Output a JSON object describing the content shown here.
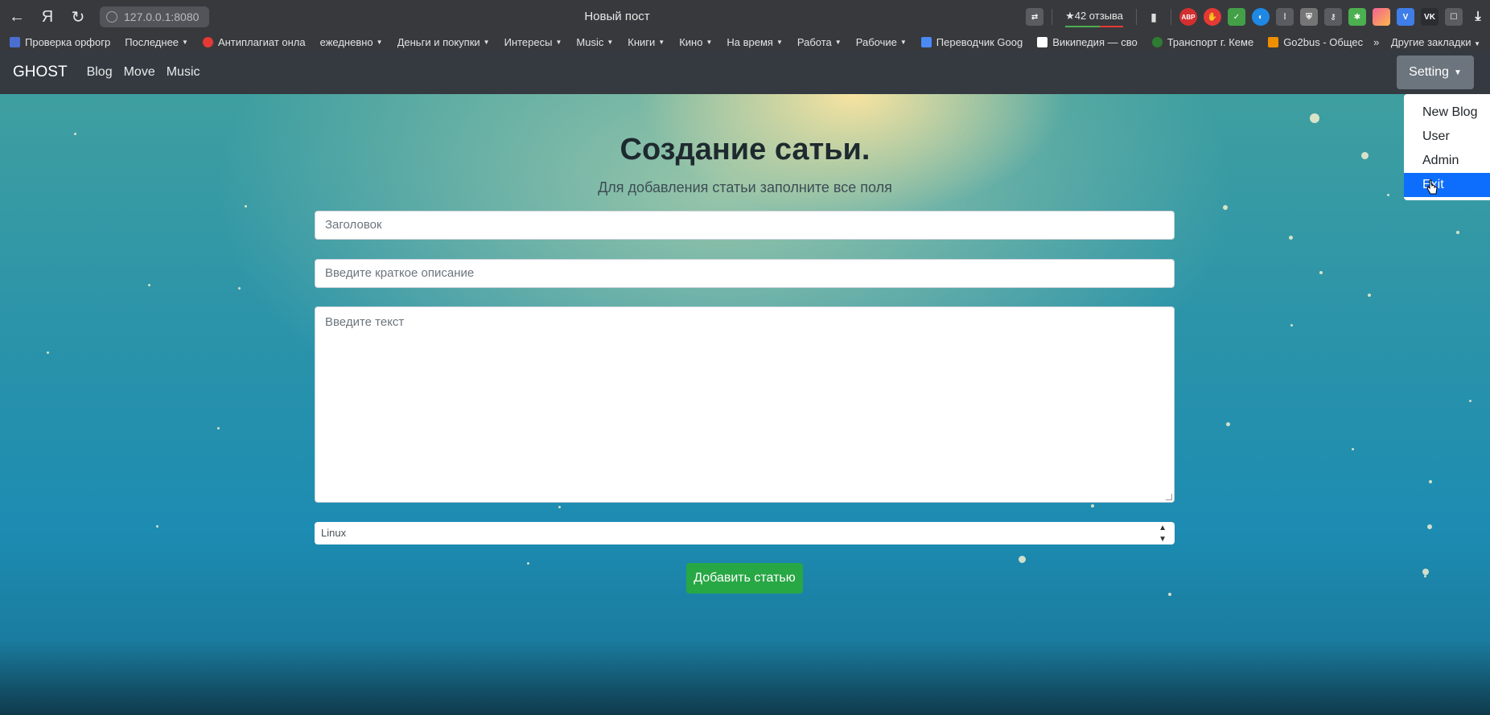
{
  "browser": {
    "url": "127.0.0.1:8080",
    "tab_title": "Новый пост",
    "rating": "★42 отзыва",
    "bookmarks": [
      {
        "label": "Проверка орфогр",
        "icon": "grid-icon",
        "color": "#4a6fd1",
        "caret": false
      },
      {
        "label": "Последнее",
        "icon": "",
        "color": "",
        "caret": true
      },
      {
        "label": "Антиплагиат онла",
        "icon": "antiplagiat-icon",
        "color": "#e53935",
        "caret": false
      },
      {
        "label": "ежедневно",
        "icon": "",
        "color": "",
        "caret": true
      },
      {
        "label": "Деньги и покупки",
        "icon": "",
        "color": "",
        "caret": true
      },
      {
        "label": "Интересы",
        "icon": "",
        "color": "",
        "caret": true
      },
      {
        "label": "Music",
        "icon": "",
        "color": "",
        "caret": true
      },
      {
        "label": "Книги",
        "icon": "",
        "color": "",
        "caret": true
      },
      {
        "label": "Кино",
        "icon": "",
        "color": "",
        "caret": true
      },
      {
        "label": "На время",
        "icon": "",
        "color": "",
        "caret": true
      },
      {
        "label": "Работа",
        "icon": "",
        "color": "",
        "caret": true
      },
      {
        "label": "Рабочие",
        "icon": "",
        "color": "",
        "caret": true
      },
      {
        "label": "Переводчик Goog",
        "icon": "translate-icon",
        "color": "#4a8af4",
        "caret": false
      },
      {
        "label": "Википедия — сво",
        "icon": "wikipedia-icon",
        "color": "#ffffff",
        "caret": false
      },
      {
        "label": "Транспорт г. Кеме",
        "icon": "transport-icon",
        "color": "#2e7d32",
        "caret": false
      },
      {
        "label": "Go2bus - Общес",
        "icon": "bus-icon",
        "color": "#ef8f00",
        "caret": false
      }
    ],
    "other_bookmarks": "Другие закладки"
  },
  "navbar": {
    "brand": "GHOST",
    "links": [
      "Blog",
      "Move",
      "Music"
    ],
    "setting": "Setting"
  },
  "dropdown": {
    "items": [
      "New Blog",
      "User",
      "Admin",
      "Exit"
    ],
    "active_index": 3
  },
  "form": {
    "heading": "Создание сатьи.",
    "subheading": "Для добавления статьи заполните все поля",
    "title_placeholder": "Заголовок",
    "description_placeholder": "Введите краткое описание",
    "text_placeholder": "Введите текст",
    "category_selected": "Linux",
    "submit_label": "Добавить статью"
  },
  "colors": {
    "navbar": "#343a40",
    "setting_button": "#6c757d",
    "submit_button": "#28a745",
    "dropdown_active": "#0d6efd"
  }
}
